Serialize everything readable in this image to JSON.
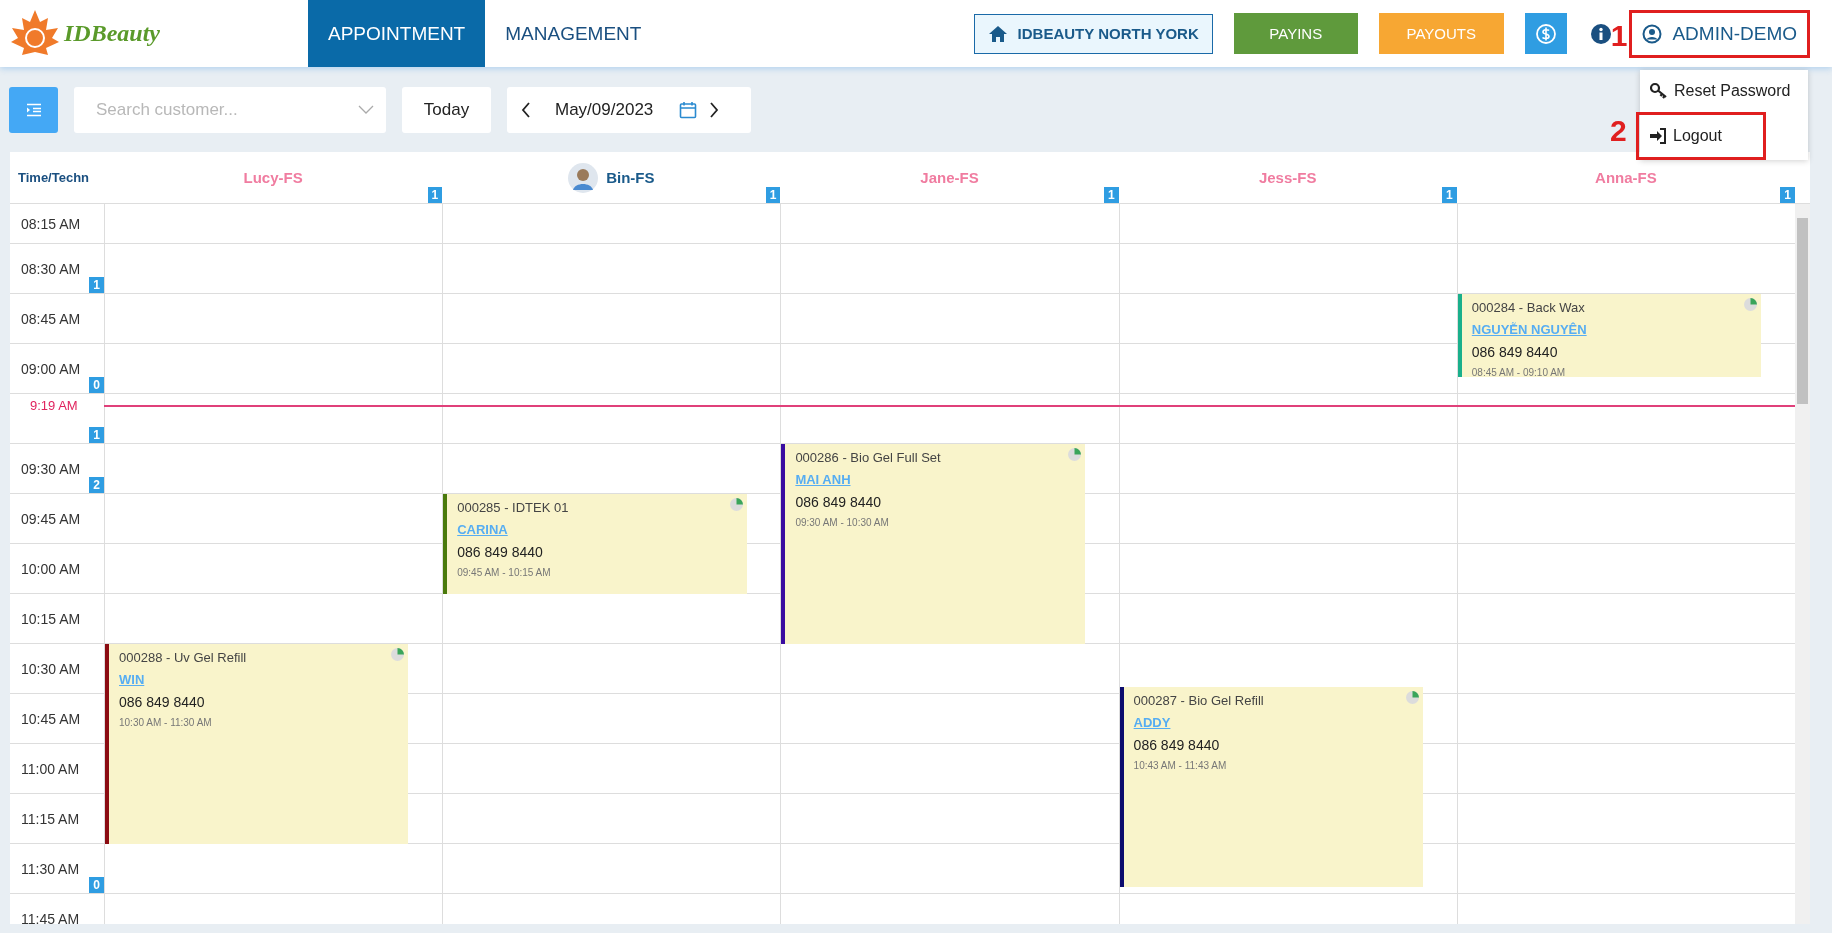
{
  "logo": {
    "text": "IDBeauty"
  },
  "nav_tabs": [
    {
      "label": "APPOINTMENT",
      "selected": true
    },
    {
      "label": "MANAGEMENT",
      "selected": false
    }
  ],
  "store_button": {
    "label": "IDBEAUTY NORTH YORK"
  },
  "action_buttons": [
    {
      "label": "PAYINS",
      "kind": "payins"
    },
    {
      "label": "PAYOUTS",
      "kind": "payouts"
    }
  ],
  "user_menu": {
    "label": "ADMIN-DEMO",
    "marker": "1",
    "items": [
      {
        "label": "Reset Password",
        "kind": "key"
      },
      {
        "label": "Logout",
        "kind": "logout",
        "marker": "2"
      }
    ]
  },
  "toolbar": {
    "search": {
      "placeholder": "Search customer..."
    },
    "today_button": "Today",
    "date": "May/09/2023"
  },
  "calendar": {
    "corner_label": "Time/Techn",
    "time_rows": [
      {
        "label": "08:15 AM"
      },
      {
        "label": "08:30 AM",
        "count": "1"
      },
      {
        "label": "08:45 AM"
      },
      {
        "label": "09:00 AM",
        "count": "0"
      },
      {
        "label": "9:19 AM",
        "kind": "now",
        "count": "1"
      },
      {
        "label": "09:30 AM",
        "count": "2"
      },
      {
        "label": "09:45 AM"
      },
      {
        "label": "10:00 AM"
      },
      {
        "label": "10:15 AM"
      },
      {
        "label": "10:30 AM"
      },
      {
        "label": "10:45 AM"
      },
      {
        "label": "11:00 AM"
      },
      {
        "label": "11:15 AM"
      },
      {
        "label": "11:30 AM",
        "count": "0"
      },
      {
        "label": "11:45 AM"
      }
    ],
    "technicians": [
      {
        "name": "Lucy-FS",
        "color": "#f07ca0",
        "avatar": false,
        "count": "1",
        "appointments": [
          {
            "title": "000288 - Uv Gel Refill",
            "customer": "WIN",
            "phone": "086 849 8440",
            "time": "10:30 AM - 11:30 AM",
            "color": "#8b0c12"
          }
        ]
      },
      {
        "name": "Bin-FS",
        "color": "#1a5a8a",
        "avatar": true,
        "count": "1",
        "appointments": [
          {
            "title": "000285 - IDTEK 01",
            "customer": "CARINA",
            "phone": "086 849 8440",
            "time": "09:45 AM - 10:15 AM",
            "color": "#4a7a0c"
          }
        ]
      },
      {
        "name": "Jane-FS",
        "color": "#f07ca0",
        "avatar": false,
        "count": "1",
        "appointments": [
          {
            "title": "000286 - Bio Gel Full Set",
            "customer": "MAI ANH",
            "phone": "086 849 8440",
            "time": "09:30 AM - 10:30 AM",
            "color": "#3a0ca0"
          }
        ]
      },
      {
        "name": "Jess-FS",
        "color": "#f07ca0",
        "avatar": false,
        "count": "1",
        "appointments": [
          {
            "title": "000287 - Bio Gel Refill",
            "customer": "ADDY",
            "phone": "086 849 8440",
            "time": "10:43 AM - 11:43 AM",
            "color": "#0c0c6e"
          }
        ]
      },
      {
        "name": "Anna-FS",
        "color": "#f07ca0",
        "avatar": false,
        "count": "1",
        "appointments": [
          {
            "title": "000284 - Back Wax",
            "customer": "NGUYỄN NGUYÊN",
            "phone": "086 849 8440",
            "time": "08:45 AM - 09:10 AM",
            "color": "#1aaf8b"
          }
        ]
      }
    ]
  }
}
